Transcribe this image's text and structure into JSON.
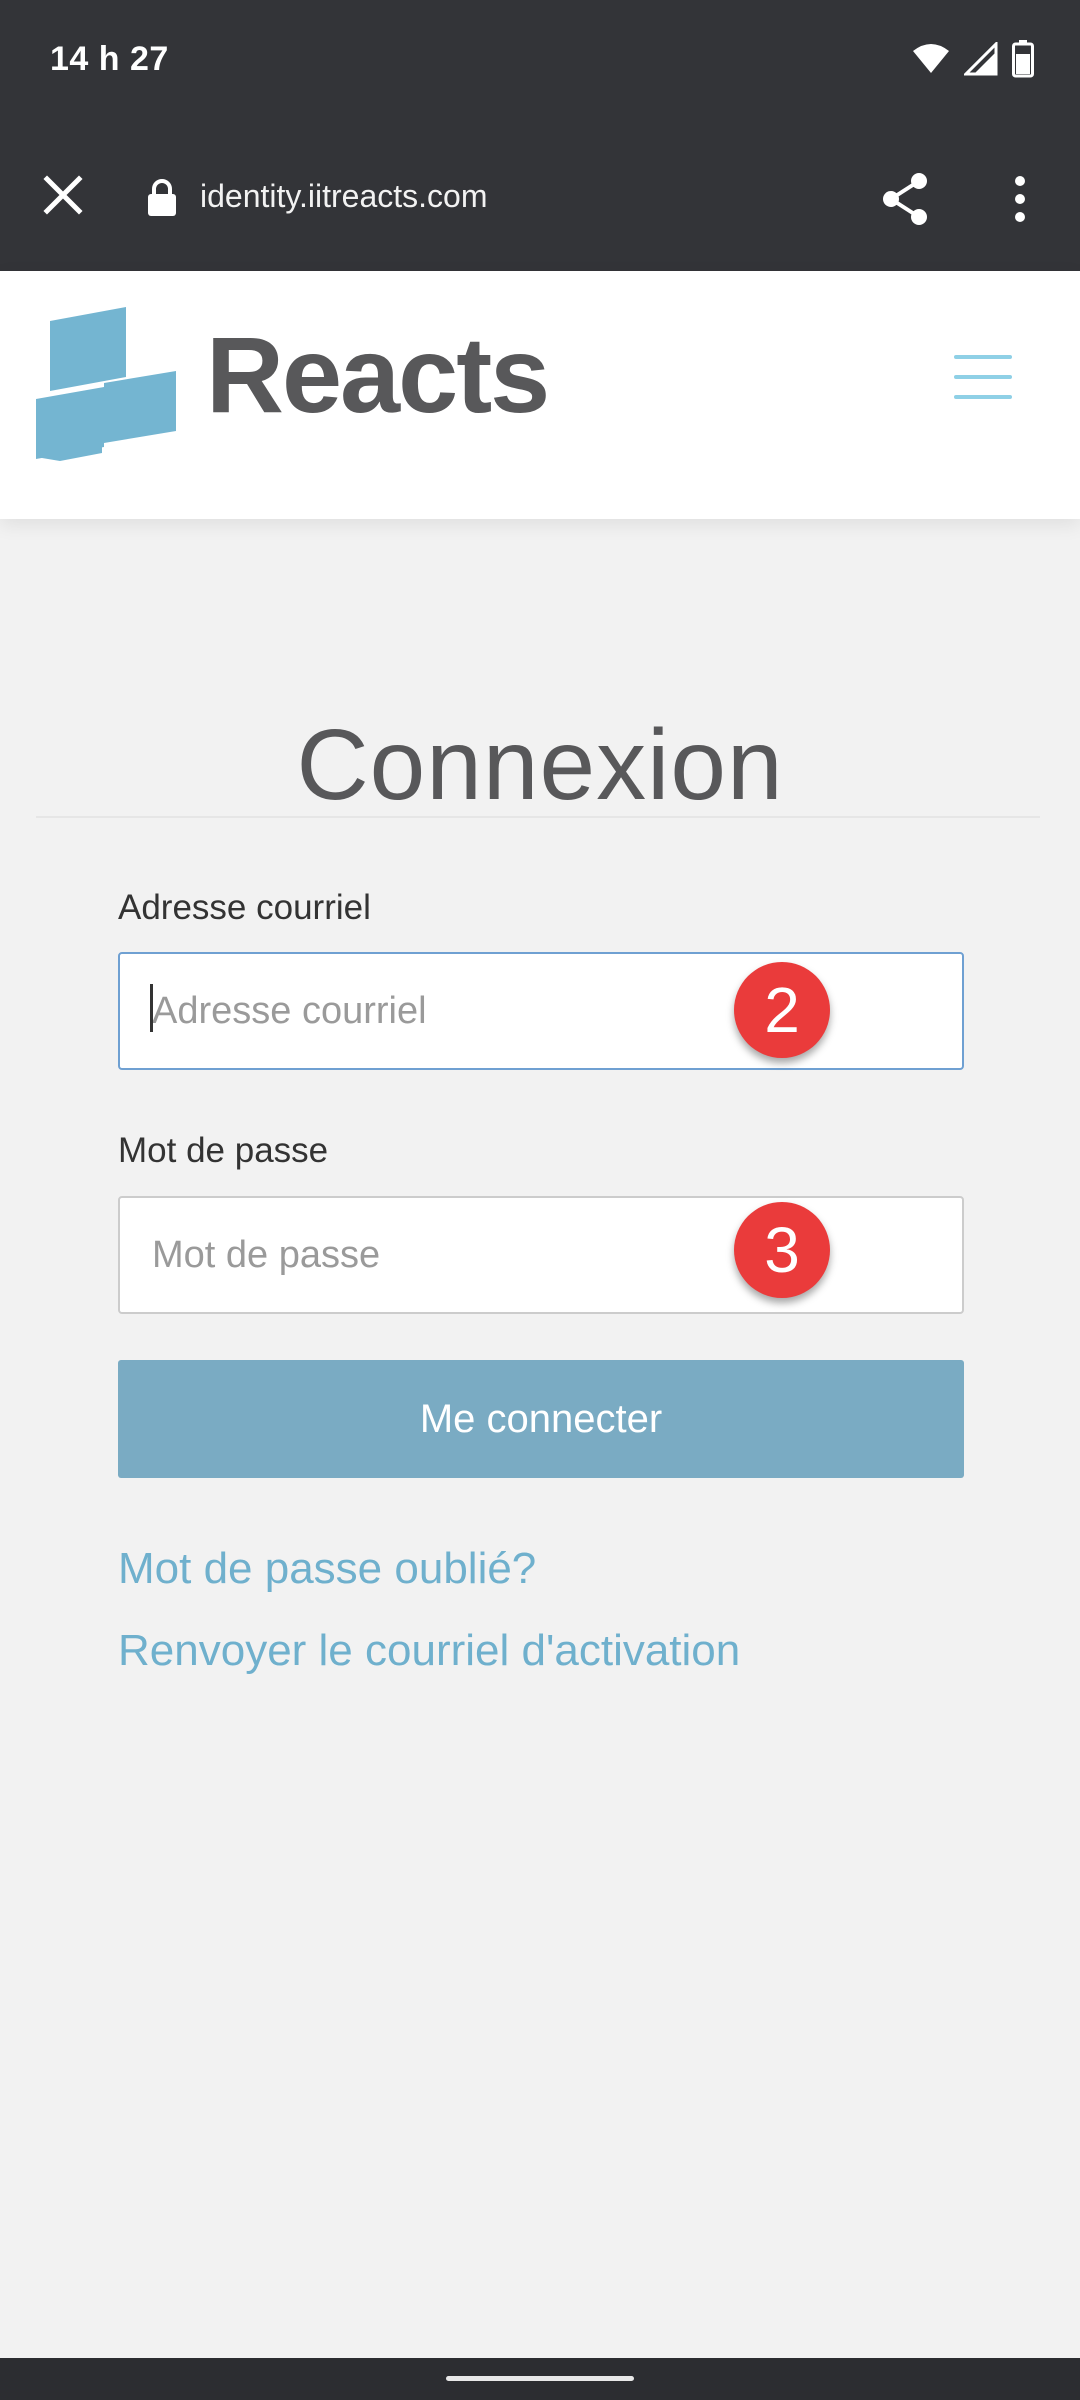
{
  "status_bar": {
    "time": "14 h 27",
    "icons": [
      "wifi-icon",
      "cellular-signal-icon",
      "battery-icon"
    ]
  },
  "browser": {
    "url": "identity.iitreacts.com",
    "icons": [
      "close-icon",
      "lock-icon",
      "share-icon",
      "more-vert-icon"
    ]
  },
  "header": {
    "logo_text": "Reacts",
    "menu_icon": "hamburger-icon"
  },
  "main": {
    "title": "Connexion",
    "email": {
      "label": "Adresse courriel",
      "placeholder": "Adresse courriel",
      "value": "",
      "annotation": "2"
    },
    "password": {
      "label": "Mot de passe",
      "placeholder": "Mot de passe",
      "value": "",
      "annotation": "3"
    },
    "submit_label": "Me connecter",
    "links": {
      "forgot_password": "Mot de passe oublié?",
      "resend_activation": "Renvoyer le courriel d'activation"
    }
  },
  "colors": {
    "chrome_bg": "#333438",
    "page_bg": "#f2f2f2",
    "brand_blue": "#7aabc3",
    "link_blue": "#6fb0cd",
    "badge_red": "#ea3b3b",
    "logo_gray": "#58585a"
  }
}
